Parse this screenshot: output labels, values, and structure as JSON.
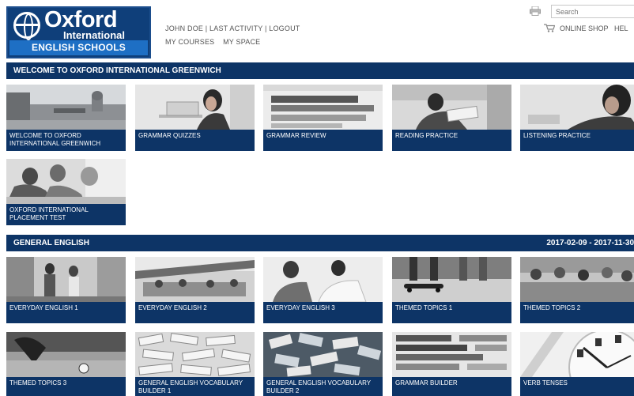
{
  "logo": {
    "name": "Oxford",
    "sub": "International",
    "banner": "ENGLISH SCHOOLS"
  },
  "header": {
    "user_links": "JOHN DOE | LAST ACTIVITY | LOGOUT",
    "nav": [
      "MY COURSES",
      "MY SPACE"
    ],
    "search_placeholder": "Search",
    "shop_link": "ONLINE SHOP",
    "help_link": "HEL"
  },
  "sections": [
    {
      "title": "WELCOME TO OXFORD INTERNATIONAL GREENWICH",
      "date": "",
      "tiles": [
        {
          "label": "WELCOME TO OXFORD INTERNATIONAL GREENWICH",
          "image": "greenwich-building"
        },
        {
          "label": "GRAMMAR QUIZZES",
          "image": "woman-laptop"
        },
        {
          "label": "GRAMMAR REVIEW",
          "image": "dictionary-text"
        },
        {
          "label": "READING PRACTICE",
          "image": "man-reading"
        },
        {
          "label": "LISTENING PRACTICE",
          "image": "woman-headphones"
        },
        {
          "label": "OXFORD INTERNATIONAL PLACEMENT TEST",
          "image": "students-writing"
        }
      ]
    },
    {
      "title": "GENERAL ENGLISH",
      "date": "2017-02-09 - 2017-11-30",
      "tiles": [
        {
          "label": "EVERYDAY ENGLISH 1",
          "image": "people-shopping"
        },
        {
          "label": "EVERYDAY ENGLISH 2",
          "image": "cafe-terrace"
        },
        {
          "label": "EVERYDAY ENGLISH 3",
          "image": "doctor-patient"
        },
        {
          "label": "THEMED TOPICS 1",
          "image": "skateboard"
        },
        {
          "label": "THEMED TOPICS 2",
          "image": "friends-group"
        },
        {
          "label": "THEMED TOPICS 3",
          "image": "football-player"
        },
        {
          "label": "GENERAL ENGLISH VOCABULARY BUILDER 1",
          "image": "word-tiles"
        },
        {
          "label": "GENERAL ENGLISH VOCABULARY BUILDER 2",
          "image": "word-blocks"
        },
        {
          "label": "GRAMMAR BUILDER",
          "image": "success-text"
        },
        {
          "label": "VERB TENSES",
          "image": "clock-face"
        }
      ]
    }
  ]
}
